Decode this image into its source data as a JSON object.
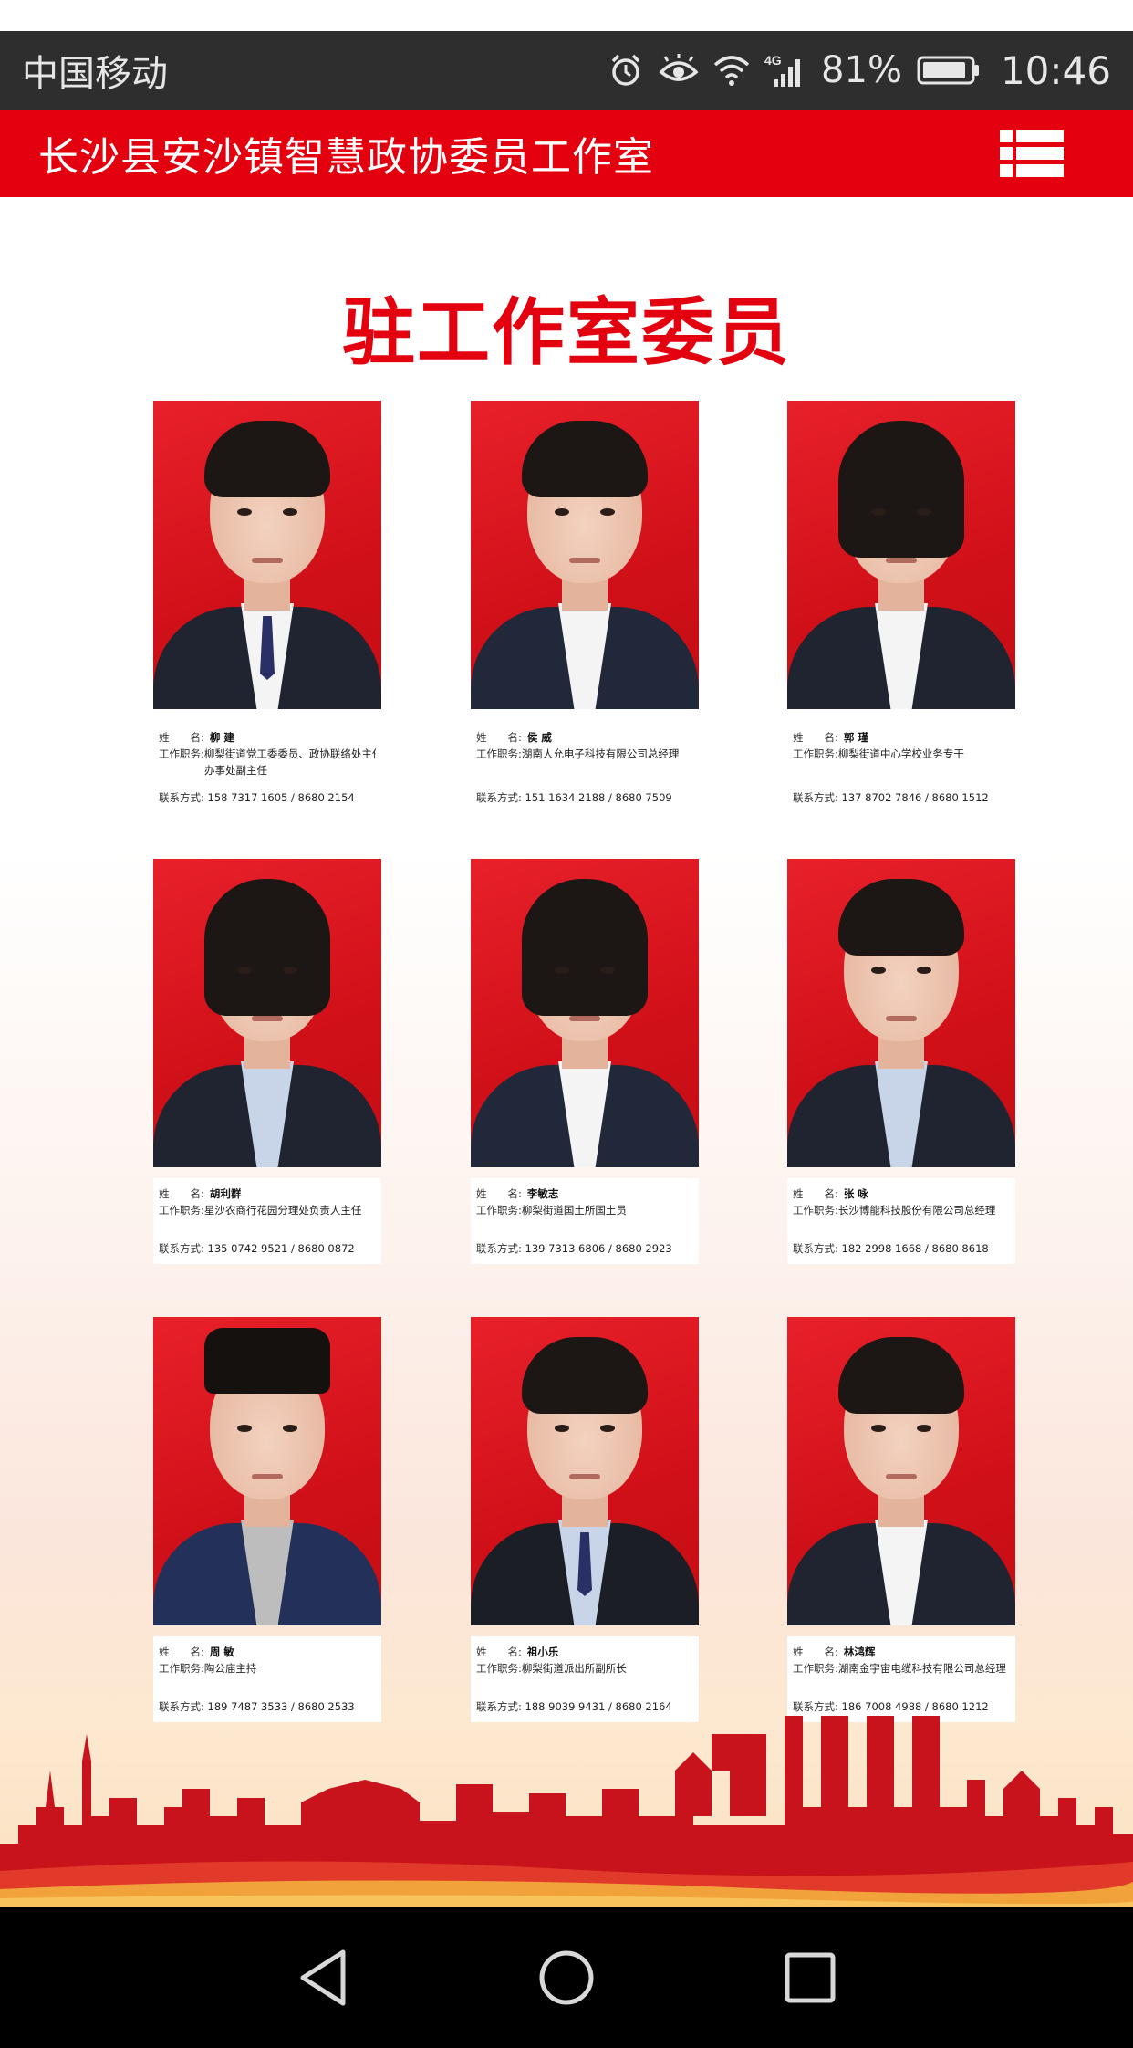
{
  "status_bar": {
    "carrier": "中国移动",
    "network": "4G",
    "battery_percent": "81%",
    "time": "10:46",
    "icons": [
      "alarm-icon",
      "eye-icon",
      "wifi-icon",
      "signal-icon",
      "battery-icon"
    ]
  },
  "header": {
    "title": "长沙县安沙镇智慧政协委员工作室",
    "menu_icon": "menu-icon",
    "background": "#e3000f"
  },
  "main": {
    "heading": "驻工作室委员",
    "labels": {
      "name": "姓　　名:",
      "position": "工作职务:",
      "contact": "联系方式:"
    },
    "members": [
      {
        "name": "柳 建",
        "position": "柳梨街道党工委委员、政协联络处主任、",
        "position_line2": "办事处副主任",
        "contact": "158 7317 1605 / 8680 2154"
      },
      {
        "name": "侯 威",
        "position": "湖南人允电子科技有限公司总经理",
        "position_line2": "",
        "contact": "151 1634 2188 / 8680 7509"
      },
      {
        "name": "郭 瑾",
        "position": "柳梨街道中心学校业务专干",
        "position_line2": "",
        "contact": "137 8702 7846 / 8680 1512"
      },
      {
        "name": "胡利群",
        "position": "星沙农商行花园分理处负责人主任",
        "position_line2": "",
        "contact": "135 0742 9521 / 8680 0872"
      },
      {
        "name": "李敏志",
        "position": "柳梨街道国土所国土员",
        "position_line2": "",
        "contact": "139 7313 6806 / 8680 2923"
      },
      {
        "name": "张 咏",
        "position": "长沙博能科技股份有限公司总经理",
        "position_line2": "",
        "contact": "182 2998 1668 / 8680 8618"
      },
      {
        "name": "周 敏",
        "position": "陶公庙主持",
        "position_line2": "",
        "contact": "189 7487 3533 / 8680 2533"
      },
      {
        "name": "祖小乐",
        "position": "柳梨街道派出所副所长",
        "position_line2": "",
        "contact": "188 9039 9431 / 8680 2164"
      },
      {
        "name": "林鸿辉",
        "position": "湖南金宇宙电缆科技有限公司总经理",
        "position_line2": "",
        "contact": "186 7008 4988 / 8680 1212"
      }
    ]
  },
  "nav_bar": {
    "back_icon": "back-triangle-icon",
    "home_icon": "home-circle-icon",
    "recents_icon": "recents-square-icon"
  }
}
